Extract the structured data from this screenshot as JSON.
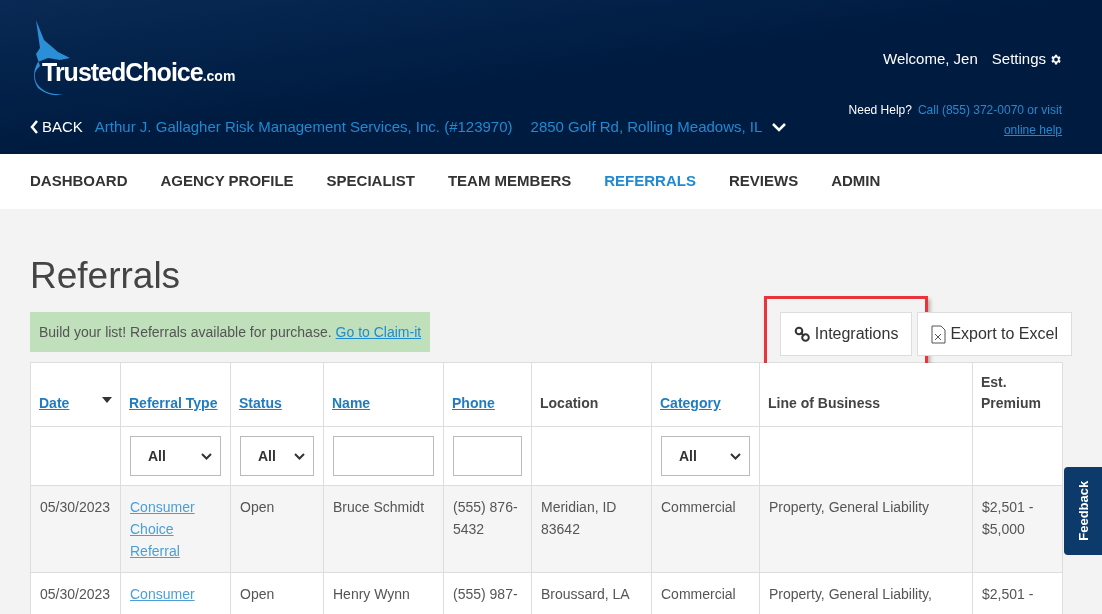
{
  "header": {
    "logo": {
      "name": "TrustedChoice",
      "suffix": ".com"
    },
    "welcome": "Welcome, Jen",
    "settings": "Settings",
    "back": "BACK",
    "agency": "Arthur J. Gallagher Risk Management Services, Inc. (#123970)",
    "address": "2850 Golf Rd, Rolling Meadows, IL",
    "help_label": "Need Help?",
    "help_text": "Call (855) 372-0070 or visit",
    "help_link": "online help"
  },
  "nav": [
    {
      "label": "DASHBOARD",
      "selected": false
    },
    {
      "label": "AGENCY PROFILE",
      "selected": false
    },
    {
      "label": "SPECIALIST",
      "selected": false
    },
    {
      "label": "TEAM MEMBERS",
      "selected": false
    },
    {
      "label": "REFERRALS",
      "selected": true
    },
    {
      "label": "REVIEWS",
      "selected": false
    },
    {
      "label": "ADMIN",
      "selected": false
    }
  ],
  "page_title": "Referrals",
  "banner": {
    "text": "Build your list! Referrals available for purchase.",
    "link": "Go to Claim-it"
  },
  "buttons": [
    {
      "kind": "link",
      "label": "Integrations",
      "highlighted": true
    },
    {
      "kind": "excel",
      "label": "Export to Excel",
      "highlighted": false
    }
  ],
  "table": {
    "columns": [
      {
        "label": "Date",
        "sortable": true,
        "sorted": true,
        "filter": {
          "kind": "none"
        }
      },
      {
        "label": "Referral Type",
        "sortable": true,
        "sorted": false,
        "filter": {
          "kind": "select",
          "value": "All"
        }
      },
      {
        "label": "Status",
        "sortable": true,
        "sorted": false,
        "filter": {
          "kind": "select",
          "value": "All"
        }
      },
      {
        "label": "Name",
        "sortable": true,
        "sorted": false,
        "filter": {
          "kind": "text"
        }
      },
      {
        "label": "Phone",
        "sortable": true,
        "sorted": false,
        "filter": {
          "kind": "text"
        }
      },
      {
        "label": "Location",
        "sortable": false,
        "sorted": false,
        "filter": {
          "kind": "none"
        }
      },
      {
        "label": "Category",
        "sortable": true,
        "sorted": false,
        "filter": {
          "kind": "select",
          "value": "All"
        }
      },
      {
        "label": "Line of Business",
        "sortable": false,
        "sorted": false,
        "filter": {
          "kind": "none"
        }
      },
      {
        "label": "Est. Premium",
        "sortable": false,
        "sorted": false,
        "filter": {
          "kind": "none"
        }
      }
    ],
    "rows": [
      [
        "05/30/2023",
        "Consumer Choice Referral",
        "Open",
        "Bruce Schmidt",
        "(555) 876-5432",
        "Meridian, ID 83642",
        "Commercial",
        "Property, General Liability",
        "$2,501 - $5,000"
      ],
      [
        "05/30/2023",
        "Consumer",
        "Open",
        "Henry Wynn",
        "(555) 987-",
        "Broussard, LA",
        "Commercial",
        "Property, General Liability,",
        "$2,501 -"
      ]
    ]
  },
  "feedback": "Feedback"
}
